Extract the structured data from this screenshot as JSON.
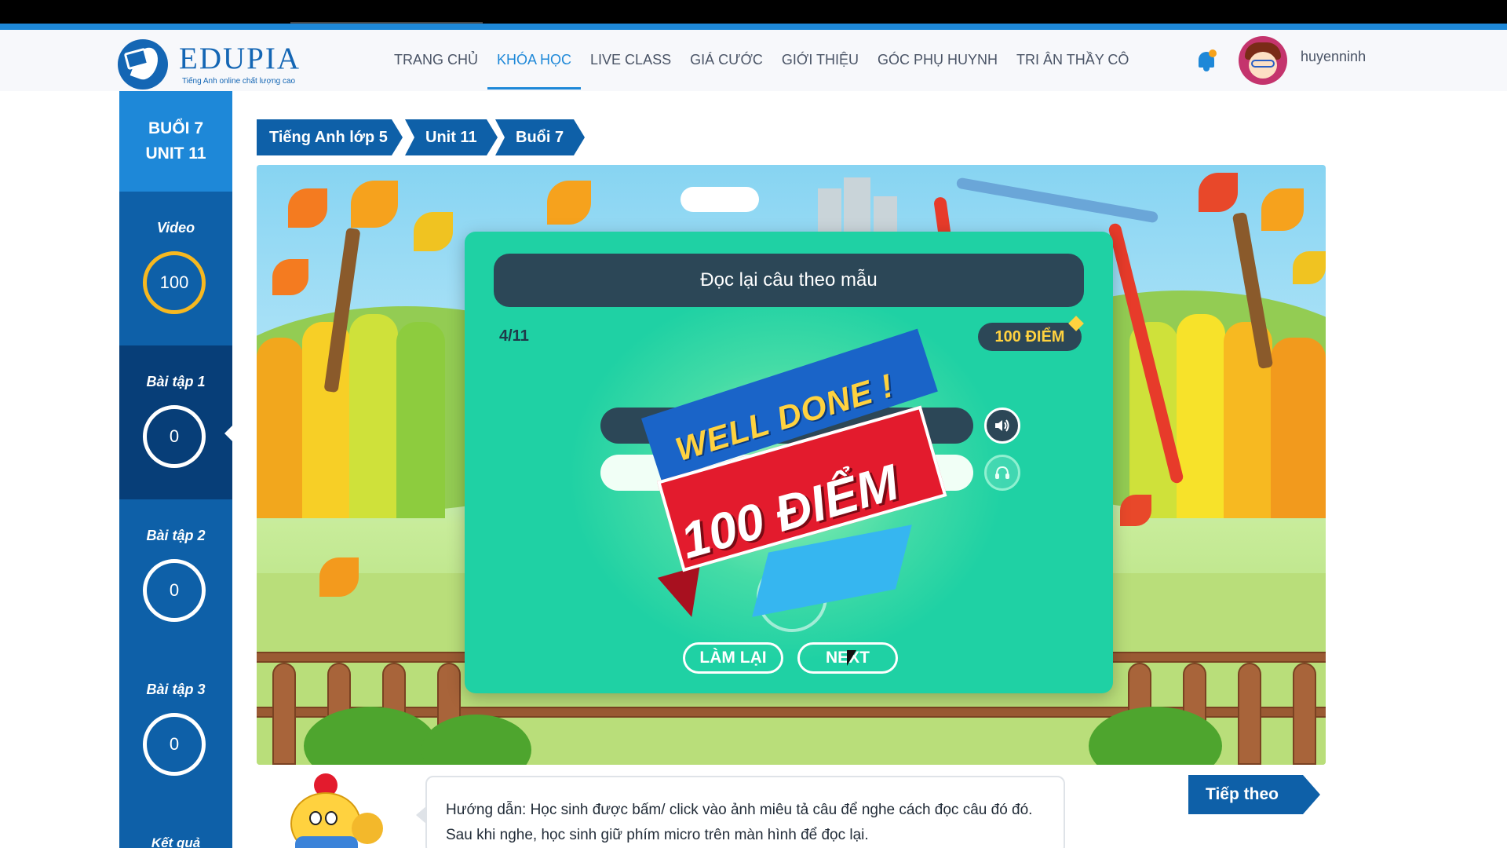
{
  "brand": {
    "name": "EDUPIA",
    "tagline": "Tiếng Anh online chất lượng cao",
    "primary_color": "#1e88d8",
    "dark_color": "#0e60a8"
  },
  "nav": {
    "items": [
      {
        "label": "TRANG CHỦ"
      },
      {
        "label": "KHÓA HỌC",
        "active": true
      },
      {
        "label": "LIVE CLASS"
      },
      {
        "label": "GIÁ CƯỚC"
      },
      {
        "label": "GIỚI THIỆU"
      },
      {
        "label": "GÓC PHỤ HUYNH"
      },
      {
        "label": "TRI ÂN THẦY CÔ"
      }
    ],
    "bell_icon": "bell-icon"
  },
  "user": {
    "name": "huyenninh"
  },
  "sidebar": {
    "head_line1": "BUỔI 7",
    "head_line2": "UNIT 11",
    "items": [
      {
        "label": "Video",
        "score": "100",
        "ring": "gold"
      },
      {
        "label": "Bài tập 1",
        "score": "0",
        "active": true
      },
      {
        "label": "Bài tập 2",
        "score": "0"
      },
      {
        "label": "Bài tập 3",
        "score": "0"
      }
    ],
    "result_label": "Kết quả"
  },
  "breadcrumb": {
    "items": [
      "Tiếng Anh lớp 5",
      "Unit 11",
      "Buổi 7"
    ]
  },
  "exercise": {
    "title": "Đọc lại câu theo mẫu",
    "counter": "4/11",
    "score_badge": "100 ĐIỂM",
    "banner_top": "WELL DONE !",
    "banner_score": "100 ĐIỂM",
    "retry_label": "LÀM LẠI",
    "next_label": "NEXT",
    "speaker_icon": "speaker-icon",
    "mic_icon": "microphone-icon"
  },
  "instruction": {
    "text": "Hướng dẫn: Học sinh được bấm/ click vào ảnh miêu tả câu để nghe cách đọc câu đó đó. Sau khi nghe, học sinh giữ phím micro trên màn hình để đọc lại."
  },
  "next_button": {
    "label": "Tiếp theo"
  }
}
